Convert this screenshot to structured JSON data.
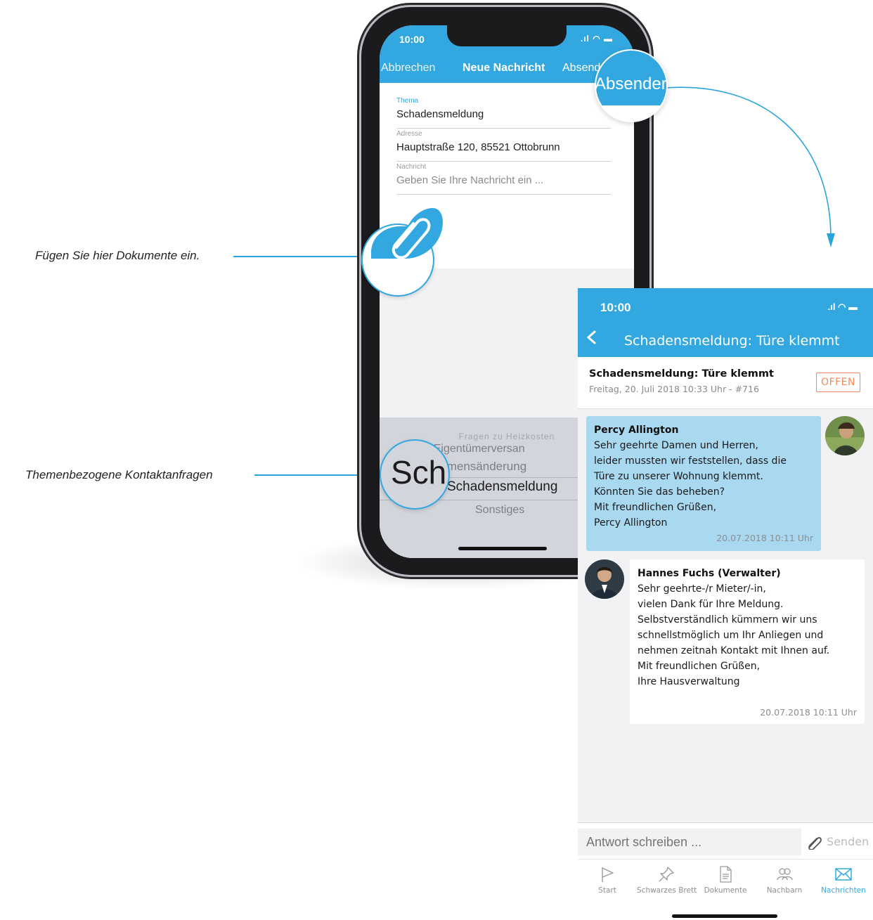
{
  "captions": {
    "documents": "Fügen Sie hier Dokumente ein.",
    "topics": "Themenbezogene Kontaktanfragen"
  },
  "compose": {
    "status_time": "10:00",
    "cancel": "Abbrechen",
    "title": "Neue Nachricht",
    "send": "Absenden",
    "send_zoom": "Absender",
    "fields": [
      {
        "label": "Thema",
        "value": "Schadensmeldung"
      },
      {
        "label": "Adresse",
        "value": "Hauptstraße 120, 85521 Ottobrunn"
      },
      {
        "label": "Nachricht",
        "placeholder": "Geben Sie Ihre Nachricht ein ..."
      }
    ],
    "picker": {
      "items": [
        "Fragen zu Heizkosten",
        "TOP Eigentümerversan",
        "Namensänderung",
        "Schadensmeldung",
        "Sonstiges"
      ],
      "selected": "Schadensmeldung",
      "zoom_text": "Sch"
    }
  },
  "thread": {
    "status_time": "10:00",
    "nav_title": "Schadensmeldung: Türe klemmt",
    "header_title": "Schadensmeldung: Türe klemmt",
    "header_sub": "Freitag, 20. Juli 2018 10:33 Uhr - #716",
    "status_badge": "OFFEN",
    "messages": [
      {
        "author": "Percy Allington",
        "lines": [
          "Sehr geehrte Damen und Herren,",
          "leider mussten wir feststellen, dass die",
          "Türe zu unserer Wohnung klemmt.",
          "Könnten Sie das beheben?",
          "Mit freundlichen Grüßen,",
          "Percy Allington"
        ],
        "time": "20.07.2018 10:11 Uhr"
      },
      {
        "author": "Hannes Fuchs (Verwalter)",
        "lines": [
          "Sehr geehrte-/r Mieter/-in,",
          "vielen Dank für Ihre Meldung.",
          "Selbstverständlich kümmern wir uns",
          "schnellstmöglich um Ihr Anliegen und",
          "nehmen zeitnah Kontakt mit Ihnen auf.",
          "Mit freundlichen Grüßen,",
          "Ihre Hausverwaltung"
        ],
        "time": "20.07.2018 10:11 Uhr"
      }
    ],
    "reply_placeholder": "Antwort schreiben ...",
    "send_label": "Senden",
    "tabs": [
      {
        "label": "Start",
        "icon": "flag-icon"
      },
      {
        "label": "Schwarzes Brett",
        "icon": "pin-icon"
      },
      {
        "label": "Dokumente",
        "icon": "document-icon"
      },
      {
        "label": "Nachbarn",
        "icon": "neighbors-icon"
      },
      {
        "label": "Nachrichten",
        "icon": "envelope-icon",
        "active": true
      }
    ]
  },
  "colors": {
    "accent": "#33a8e0",
    "bubble_own": "#a9d8f1",
    "badge": "#f08a5a"
  }
}
